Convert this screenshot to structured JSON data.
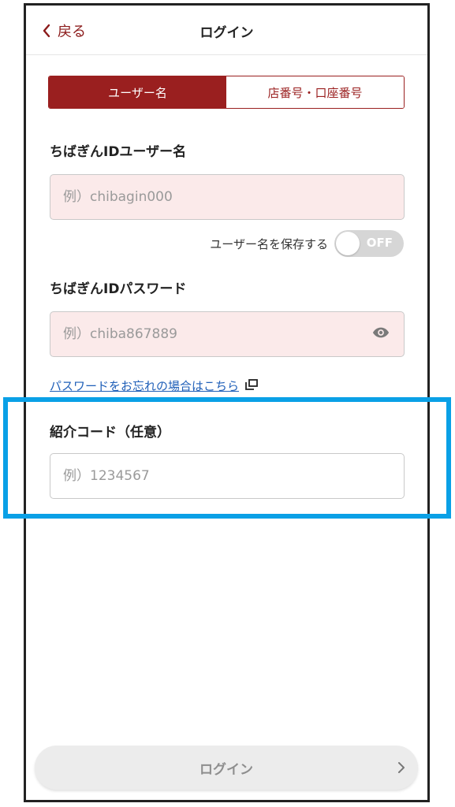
{
  "header": {
    "back_label": "戻る",
    "title": "ログイン"
  },
  "segment": {
    "tabs": [
      {
        "label": "ユーザー名",
        "active": true
      },
      {
        "label": "店番号・口座番号",
        "active": false
      }
    ]
  },
  "username": {
    "label": "ちばぎんIDユーザー名",
    "placeholder": "例）chibagin000",
    "value": ""
  },
  "save_username": {
    "label": "ユーザー名を保存する",
    "toggle_state": "OFF"
  },
  "password": {
    "label": "ちばぎんIDパスワード",
    "placeholder": "例）chiba867889",
    "value": ""
  },
  "forgot_password": {
    "label": "パスワードをお忘れの場合はこちら"
  },
  "referral": {
    "label": "紹介コード（任意）",
    "placeholder": "例）1234567",
    "value": ""
  },
  "login_button": {
    "label": "ログイン"
  },
  "colors": {
    "brand": "#9a1f1f",
    "highlight": "#0aa0e6",
    "link": "#1f5fb8",
    "input_pink": "#fbeaea"
  }
}
